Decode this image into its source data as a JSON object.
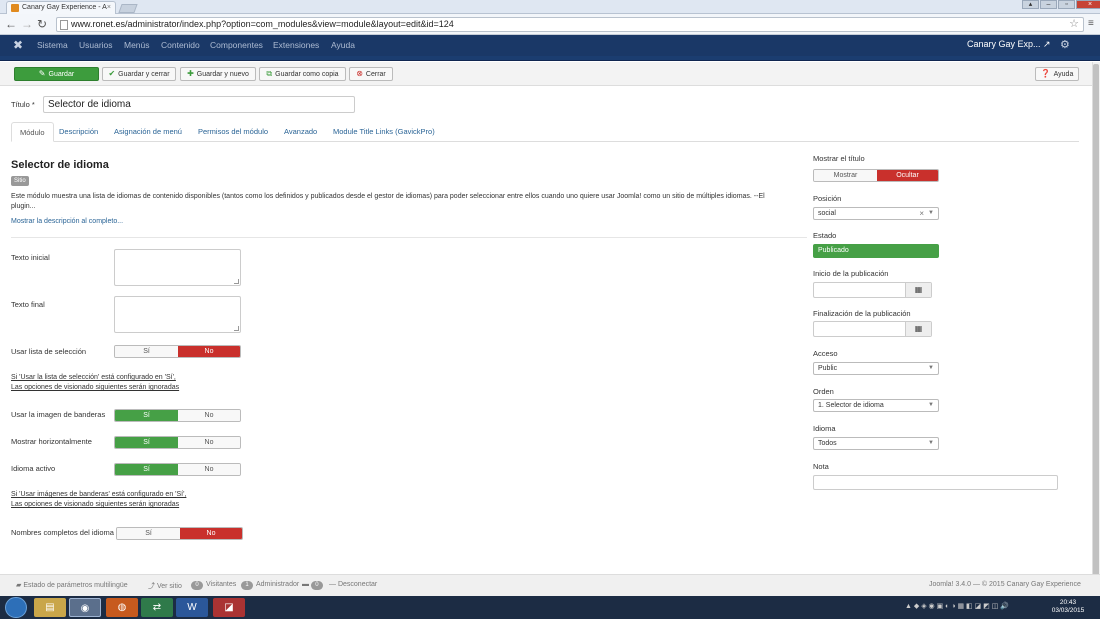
{
  "browser": {
    "tab_title": "Canary Gay Experience - A",
    "url": "www.ronet.es/administrator/index.php?option=com_modules&view=module&layout=edit&id=124"
  },
  "navbar": {
    "menu": [
      "Sistema",
      "Usuarios",
      "Menús",
      "Contenido",
      "Componentes",
      "Extensiones",
      "Ayuda"
    ],
    "site_name": "Canary Gay Exp..."
  },
  "toolbar": {
    "save": "Guardar",
    "save_close": "Guardar y cerrar",
    "save_new": "Guardar y nuevo",
    "save_copy": "Guardar como copia",
    "close": "Cerrar",
    "help": "Ayuda"
  },
  "form": {
    "title_label": "Título *",
    "title_value": "Selector de idioma",
    "tabs": [
      "Módulo",
      "Descripción",
      "Asignación de menú",
      "Permisos del módulo",
      "Avanzado",
      "Module Title Links (GavickPro)"
    ],
    "module_heading": "Selector de idioma",
    "site_badge": "Sitio",
    "description": "Este módulo muestra una lista de idiomas de contenido disponibles (tantos como los definidos y publicados desde el gestor de idiomas) para poder seleccionar entre ellos cuando uno quiere usar Joomla! como un sitio de múltiples idiomas. --El plugin...",
    "show_full": "Mostrar la descripción al completo...",
    "texto_inicial": "Texto inicial",
    "texto_final": "Texto final",
    "usar_lista": "Usar lista de selección",
    "note1_line1": "Si 'Usar la lista de selección' está configurado en 'Sí',",
    "note1_line2": "Las opciones de visionado siguientes serán ignoradas",
    "usar_imagen": "Usar la imagen de banderas",
    "mostrar_horiz": "Mostrar horizontalmente",
    "idioma_activo": "Idioma activo",
    "note2_line1": "Si 'Usar imágenes de banderas' está configurado en 'Sí',",
    "note2_line2": "Las opciones de visionado siguientes serán ignoradas",
    "nombres_completos": "Nombres completos del idioma",
    "yes": "Sí",
    "no": "No"
  },
  "sidebar": {
    "mostrar_titulo": "Mostrar el título",
    "mostrar": "Mostrar",
    "ocultar": "Ocultar",
    "posicion_label": "Posición",
    "posicion_value": "social",
    "estado_label": "Estado",
    "estado_value": "Publicado",
    "inicio_label": "Inicio de la publicación",
    "fin_label": "Finalización de la publicación",
    "acceso_label": "Acceso",
    "acceso_value": "Public",
    "orden_label": "Orden",
    "orden_value": "1. Selector de idioma",
    "idioma_label": "Idioma",
    "idioma_value": "Todos",
    "nota_label": "Nota"
  },
  "footer": {
    "multilang": "Estado de parámetros multilingüe",
    "ver_sitio": "Ver sitio",
    "visitantes_count": "0",
    "visitantes": "Visitantes",
    "admin_count": "1",
    "admin": "Administrador",
    "msg_count": "0",
    "desconectar": "Desconectar",
    "copyright": "Joomla! 3.4.0 — © 2015 Canary Gay Experience"
  },
  "taskbar": {
    "time": "20:43",
    "date": "03/03/2015"
  },
  "colors": {
    "navbar": "#1a3867",
    "success": "#46a046",
    "danger": "#c9302c",
    "link": "#2a6496"
  }
}
